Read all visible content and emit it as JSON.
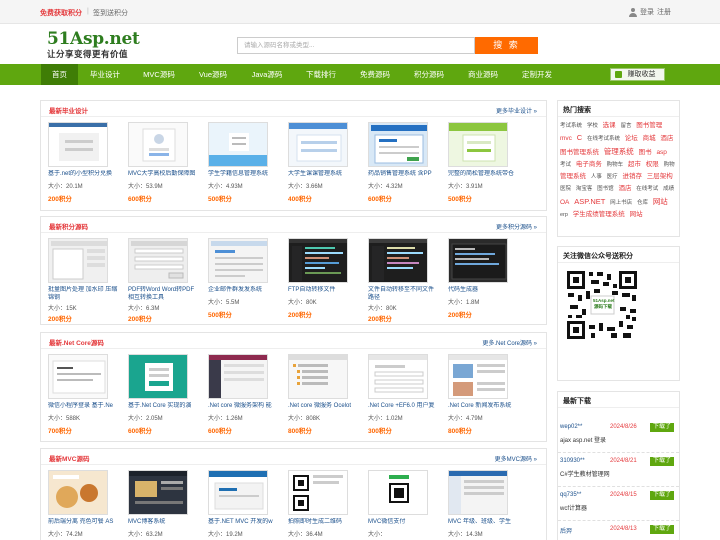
{
  "topbar": {
    "promo": "免费获取积分",
    "sep": "|",
    "signin": "签到送积分",
    "login": "登录",
    "register": "注册"
  },
  "header": {
    "logo": "51Asp.net",
    "slogan": "让分享变得更有价值",
    "search_placeholder": "请输入源码名称或类型...",
    "search_button": "搜 索"
  },
  "nav": {
    "items": [
      "首页",
      "毕业设计",
      "MVC源码",
      "Vue源码",
      "Java源码",
      "下载排行",
      "免费源码",
      "积分源码",
      "商业源码",
      "定制开发"
    ],
    "earn_button": "赚取收益"
  },
  "sections": [
    {
      "title": "最新毕业设计",
      "more": "更多毕业设计 »",
      "items": [
        {
          "title": "基于.net的小型积分兑换",
          "size": "大小：20.1M",
          "points": "200积分"
        },
        {
          "title": "MVC大学高校后勤保障图",
          "size": "大小：53.9M",
          "points": "600积分"
        },
        {
          "title": "学生学籍信息管理系统",
          "size": "大小：4.93M",
          "points": "500积分"
        },
        {
          "title": "大学生课课管理系统",
          "size": "大小：3.66M",
          "points": "400积分"
        },
        {
          "title": "药品销售管理系统 含PP",
          "size": "大小：4.32M",
          "points": "600积分"
        },
        {
          "title": "完整的简松管理系统带仓",
          "size": "大小：3.91M",
          "points": "500积分"
        }
      ]
    },
    {
      "title": "最新积分源码",
      "more": "更多积分源码 »",
      "items": [
        {
          "title": "批量图片处理 加水印 压缩锦钢",
          "size": "大小：15K",
          "points": "200积分"
        },
        {
          "title": "PDF转Word Word转PDF 相互转换工具",
          "size": "大小：6.3M",
          "points": "200积分"
        },
        {
          "title": "企业邮件群发发系统",
          "size": "大小：5.5M",
          "points": "500积分"
        },
        {
          "title": "FTP自动转移文件",
          "size": "大小：80K",
          "points": "200积分"
        },
        {
          "title": "文件自动转移至不同文件路径",
          "size": "大小：80K",
          "points": "200积分"
        },
        {
          "title": "代码生成器",
          "size": "大小：1.8M",
          "points": "200积分"
        }
      ]
    },
    {
      "title": "最新.Net Core源码",
      "more": "更多.Net Core源码 »",
      "items": [
        {
          "title": "微信小程序登录 基于.Ne",
          "size": "大小：588K",
          "points": "700积分"
        },
        {
          "title": "基于.Net Core 实现的演",
          "size": "大小：2.05M",
          "points": "600积分"
        },
        {
          "title": ".Net core 微服务架构 能",
          "size": "大小：1.26M",
          "points": "600积分"
        },
        {
          "title": ".Net core 微服务 Ocelot",
          "size": "大小：808K",
          "points": "800积分"
        },
        {
          "title": ".Net Core +EF6.0 用户复",
          "size": "大小：1.02M",
          "points": "300积分"
        },
        {
          "title": ".Net Core 新闻发布系统",
          "size": "大小：4.79M",
          "points": "800积分"
        }
      ]
    },
    {
      "title": "最新MVC源码",
      "more": "更多MVC源码 »",
      "items": [
        {
          "title": "前后端分离 売色可餐 AS",
          "size": "大小：74.2M",
          "points": ""
        },
        {
          "title": "MVC博客系统",
          "size": "大小：63.2M",
          "points": ""
        },
        {
          "title": "基于.NET MVC 开发的w",
          "size": "大小：19.2M",
          "points": ""
        },
        {
          "title": "拍照即时生成二维码",
          "size": "大小：36.4M",
          "points": ""
        },
        {
          "title": "MVC微信支付",
          "size": "大小：",
          "points": ""
        },
        {
          "title": "MVC 年级、班级、学生",
          "size": "大小：14.3M",
          "points": ""
        }
      ]
    }
  ],
  "sidebar": {
    "hot_title": "热门搜索",
    "tags": [
      "考试系统",
      "学校",
      "选课",
      "留言",
      "图书管理",
      "mvc",
      "C",
      "在线考试系统",
      "论坛",
      "商城",
      "酒店",
      "图书管理系统",
      "管理系统",
      "图书",
      "asp",
      "考试",
      "电子商务",
      "购物车",
      "超市",
      "权限",
      "购物",
      "管理系统",
      "人事",
      "医疗",
      "进销存",
      "三层架构",
      "医院",
      "淘宝客",
      "图书馆",
      "酒店",
      "在线考试",
      "成绩",
      "OA",
      "ASP.NET",
      "网上书店",
      "仓库",
      "网站",
      "erp",
      "学生成绩管理系统",
      "网站"
    ],
    "wechat_title": "关注微信公众号送积分",
    "qr_label": "51Asp.net 源码下载",
    "latest_title": "最新下载",
    "downloads": [
      {
        "name": "wep02**",
        "date": "2024/8/26",
        "btn": "下载了",
        "desc": "ajax asp.net 登录"
      },
      {
        "name": "310930**",
        "date": "2024/8/21",
        "btn": "下载了",
        "desc": "C#学生教材管理网"
      },
      {
        "name": "qq735**",
        "date": "2024/8/15",
        "btn": "下载了",
        "desc": "wcf计算器"
      },
      {
        "name": "后羿",
        "date": "2024/8/13",
        "btn": "下载了",
        "desc": ""
      }
    ]
  },
  "colors": {
    "brand_green": "#5fa70f",
    "nav_active": "#3f7d06",
    "accent_orange": "#ff6600",
    "title_red": "#e4393c",
    "link_blue": "#1a4f8b"
  }
}
